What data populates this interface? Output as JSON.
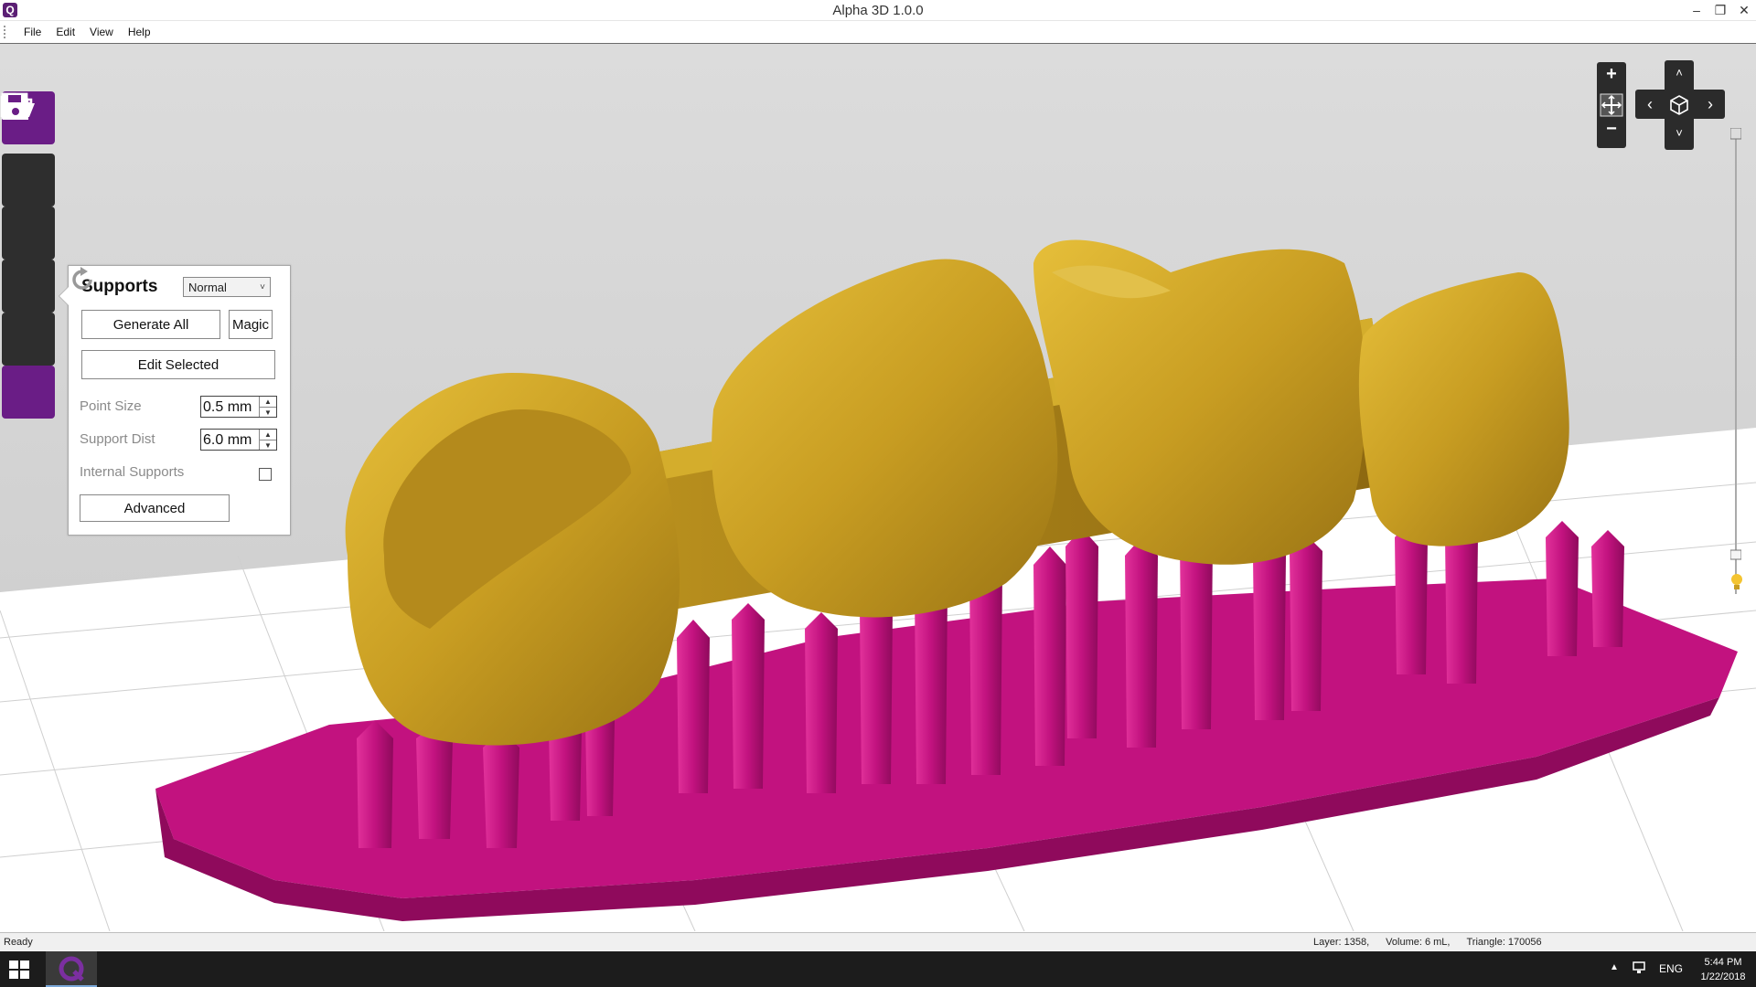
{
  "window": {
    "title": "Alpha 3D 1.0.0",
    "logo_glyph": "Q",
    "controls": {
      "minimize": "–",
      "maximize": "❐",
      "close": "✕"
    }
  },
  "menubar": {
    "items": [
      {
        "label": "File"
      },
      {
        "label": "Edit"
      },
      {
        "label": "View"
      },
      {
        "label": "Help"
      }
    ]
  },
  "sidebar": {
    "items": [
      {
        "name": "open-folder-icon",
        "active": true
      },
      {
        "name": "layout-icon",
        "active": false
      },
      {
        "name": "transform-icon",
        "active": false
      },
      {
        "name": "supports-icon",
        "active": false
      },
      {
        "name": "slice-icon",
        "active": false
      },
      {
        "name": "save-icon",
        "active": true
      }
    ]
  },
  "supports_panel": {
    "title": "Supports",
    "mode": {
      "selected": "Normal"
    },
    "generate_all_label": "Generate All",
    "magic_label": "Magic",
    "edit_selected_label": "Edit Selected",
    "point_size": {
      "label": "Point Size",
      "value": "0.5 mm"
    },
    "support_dist": {
      "label": "Support Dist",
      "value": "6.0 mm"
    },
    "internal_supports": {
      "label": "Internal Supports",
      "checked": false
    },
    "advanced_label": "Advanced"
  },
  "nav": {
    "zoom_in": "+",
    "zoom_out": "−",
    "up": "˄",
    "down": "˅",
    "left": "‹",
    "right": "›"
  },
  "colors": {
    "accent": "#6a1d86",
    "model_gold": "#c8a02a",
    "support_magenta": "#c2127f",
    "grid_bg": "#ffffff"
  },
  "statusbar": {
    "status": "Ready",
    "layer": "Layer: 1358,",
    "volume": "Volume: 6 mL,",
    "triangle": "Triangle: 170056"
  },
  "taskbar": {
    "lang": "ENG",
    "time": "5:44 PM",
    "date": "1/22/2018"
  }
}
